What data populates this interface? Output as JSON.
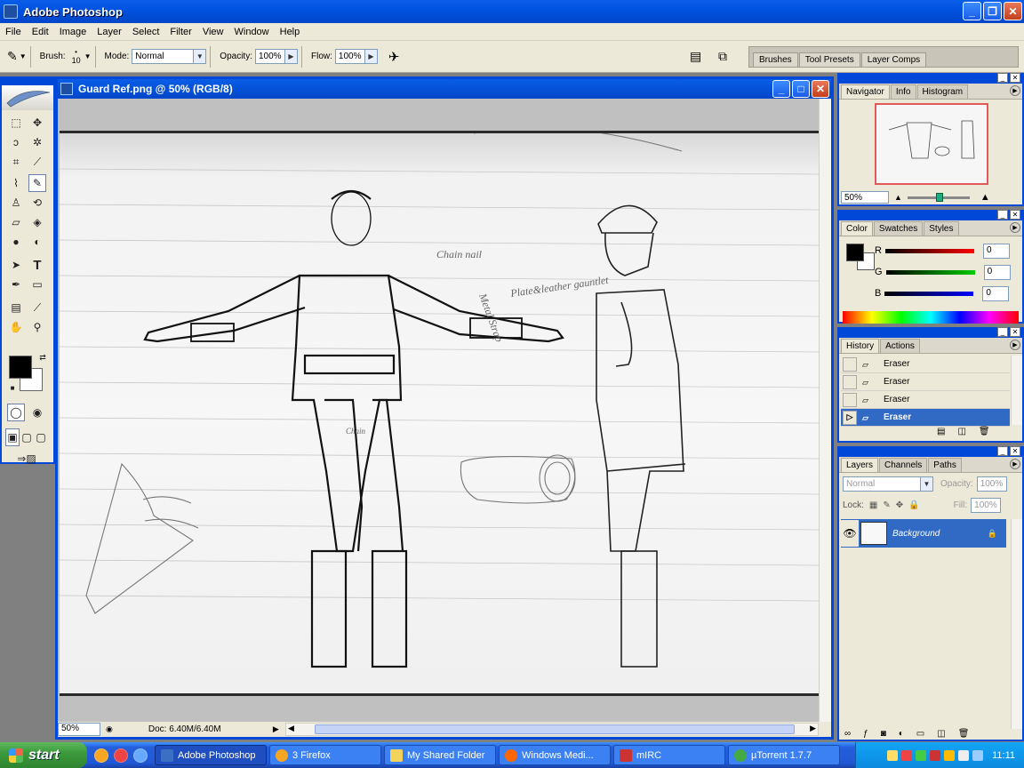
{
  "app": {
    "title": "Adobe Photoshop"
  },
  "menu": [
    "File",
    "Edit",
    "Image",
    "Layer",
    "Select",
    "Filter",
    "View",
    "Window",
    "Help"
  ],
  "options": {
    "brush_label": "Brush:",
    "brush_size": "10",
    "mode_label": "Mode:",
    "mode_value": "Normal",
    "opacity_label": "Opacity:",
    "opacity_value": "100%",
    "flow_label": "Flow:",
    "flow_value": "100%"
  },
  "well_tabs": [
    "Brushes",
    "Tool Presets",
    "Layer Comps"
  ],
  "document": {
    "title": "Guard Ref.png @ 50% (RGB/8)",
    "zoom": "50%",
    "doc_info": "Doc: 6.40M/6.40M",
    "sketch_notes": [
      "Chain nail",
      "Metal Strap",
      "Plate&leather gauntlet",
      "Chain"
    ]
  },
  "navigator": {
    "tabs": [
      "Navigator",
      "Info",
      "Histogram"
    ],
    "zoom": "50%"
  },
  "color": {
    "tabs": [
      "Color",
      "Swatches",
      "Styles"
    ],
    "channels": [
      {
        "label": "R",
        "value": "0",
        "color": "#ff0000"
      },
      {
        "label": "G",
        "value": "0",
        "color": "#00c000"
      },
      {
        "label": "B",
        "value": "0",
        "color": "#0000ff"
      }
    ]
  },
  "history": {
    "tabs": [
      "History",
      "Actions"
    ],
    "items": [
      "Eraser",
      "Eraser",
      "Eraser",
      "Eraser"
    ]
  },
  "layers": {
    "tabs": [
      "Layers",
      "Channels",
      "Paths"
    ],
    "blend_mode": "Normal",
    "opacity_label": "Opacity:",
    "opacity_value": "100%",
    "lock_label": "Lock:",
    "fill_label": "Fill:",
    "fill_value": "100%",
    "layer_name": "Background"
  },
  "taskbar": {
    "start": "start",
    "tasks": [
      "Adobe Photoshop",
      "3 Firefox",
      "My Shared Folder",
      "Windows Medi...",
      "mIRC",
      "µTorrent 1.7.7"
    ],
    "clock": "11:11"
  }
}
